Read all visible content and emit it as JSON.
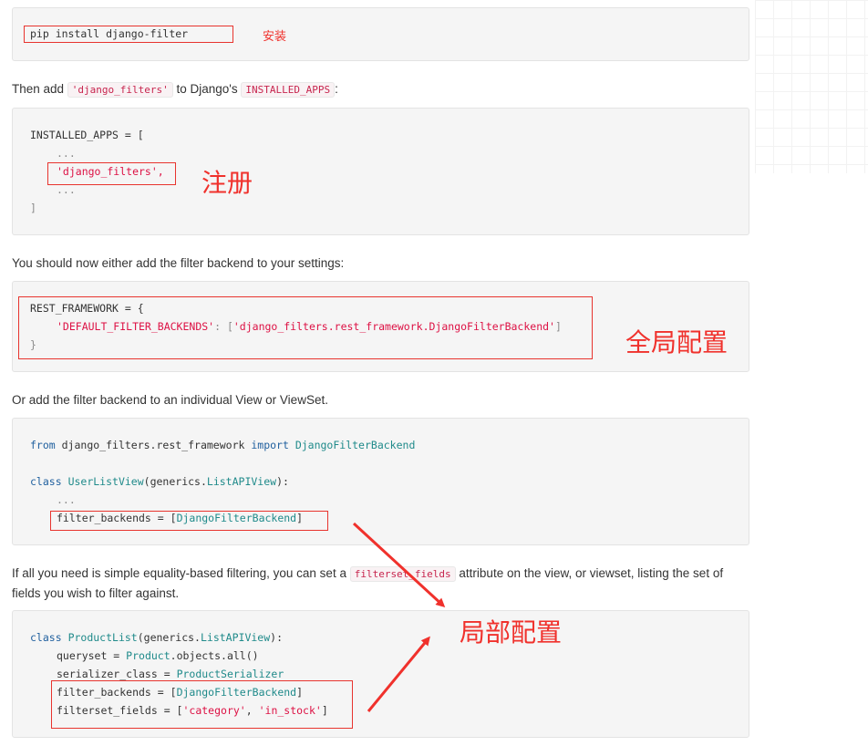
{
  "block1": {
    "line1": "pip install django-filter"
  },
  "annotations": {
    "install": "安装",
    "register": "注册",
    "global_config": "全局配置",
    "local_config": "局部配置"
  },
  "para1": {
    "before": "Then add ",
    "code1": "'django_filters'",
    "mid": " to Django's ",
    "code2": "INSTALLED_APPS",
    "after": ":"
  },
  "block2": {
    "l1": "INSTALLED_APPS = [",
    "l2": "...",
    "l3": "'django_filters',",
    "l4": "...",
    "l5": "]"
  },
  "para2": {
    "text": "You should now either add the filter backend to your settings:"
  },
  "block3": {
    "l1": "REST_FRAMEWORK = {",
    "l2_key": "'DEFAULT_FILTER_BACKENDS'",
    "l2_sep": ": [",
    "l2_val": "'django_filters.rest_framework.DjangoFilterBackend'",
    "l2_end": "]",
    "l3": "}"
  },
  "para3": {
    "text": "Or add the filter backend to an individual View or ViewSet."
  },
  "block4": {
    "l1_from": "from",
    "l1_mod": " django_filters.rest_framework ",
    "l1_import": "import",
    "l1_name": " DjangoFilterBackend",
    "l3_class": "class",
    "l3_name": "UserListView",
    "l3_paren": "(generics.",
    "l3_base": "ListAPIView",
    "l3_end": "):",
    "l4": "...",
    "l5_attr": "filter_backends = [",
    "l5_val": "DjangoFilterBackend",
    "l5_end": "]"
  },
  "para4": {
    "before": "If all you need is simple equality-based filtering, you can set a ",
    "code": "filterset_fields",
    "after": " attribute on the view, or viewset, listing the set of fields you wish to filter against."
  },
  "block5": {
    "l1_class": "class",
    "l1_name": "ProductList",
    "l1_paren": "(generics.",
    "l1_base": "ListAPIView",
    "l1_end": "):",
    "l2_attr": "queryset = ",
    "l2_val": "Product",
    "l2_rest": ".objects.all()",
    "l3_attr": "serializer_class = ",
    "l3_val": "ProductSerializer",
    "l4_attr": "filter_backends = [",
    "l4_val": "DjangoFilterBackend",
    "l4_end": "]",
    "l5_attr": "filterset_fields = [",
    "l5_v1": "'category'",
    "l5_sep": ", ",
    "l5_v2": "'in_stock'",
    "l5_end": "]"
  }
}
